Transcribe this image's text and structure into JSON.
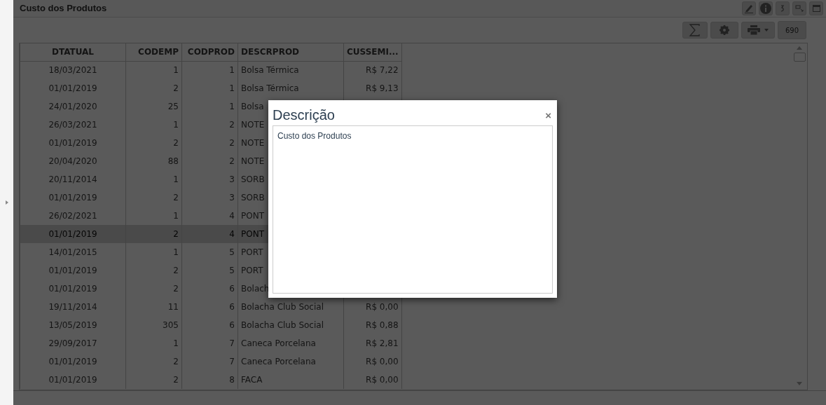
{
  "panel": {
    "title": "Custo dos Produtos",
    "record_count": "690"
  },
  "table": {
    "columns": [
      "DTATUAL",
      "CODEMP",
      "CODPROD",
      "DESCRPROD",
      "CUSSEMI..."
    ],
    "rows": [
      {
        "dtatual": "18/03/2021",
        "codemp": "1",
        "codprod": "1",
        "descrprod": "Bolsa Térmica",
        "cussemi": "R$ 7,22",
        "selected": false
      },
      {
        "dtatual": "01/01/2019",
        "codemp": "2",
        "codprod": "1",
        "descrprod": "Bolsa Térmica",
        "cussemi": "R$ 9,13",
        "selected": false
      },
      {
        "dtatual": "24/01/2020",
        "codemp": "25",
        "codprod": "1",
        "descrprod": "Bolsa",
        "selected": false
      },
      {
        "dtatual": "26/03/2021",
        "codemp": "1",
        "codprod": "2",
        "descrprod": "NOTE",
        "selected": false
      },
      {
        "dtatual": "01/01/2019",
        "codemp": "2",
        "codprod": "2",
        "descrprod": "NOTE",
        "selected": false
      },
      {
        "dtatual": "20/04/2020",
        "codemp": "88",
        "codprod": "2",
        "descrprod": "NOTE",
        "selected": false
      },
      {
        "dtatual": "20/11/2014",
        "codemp": "1",
        "codprod": "3",
        "descrprod": "SORB",
        "selected": false
      },
      {
        "dtatual": "01/01/2019",
        "codemp": "2",
        "codprod": "3",
        "descrprod": "SORB",
        "selected": false
      },
      {
        "dtatual": "26/02/2021",
        "codemp": "1",
        "codprod": "4",
        "descrprod": "PONT",
        "selected": false
      },
      {
        "dtatual": "01/01/2019",
        "codemp": "2",
        "codprod": "4",
        "descrprod": "PONT",
        "selected": true
      },
      {
        "dtatual": "14/01/2015",
        "codemp": "1",
        "codprod": "5",
        "descrprod": "PORT",
        "selected": false
      },
      {
        "dtatual": "01/01/2019",
        "codemp": "2",
        "codprod": "5",
        "descrprod": "PORT",
        "selected": false
      },
      {
        "dtatual": "01/01/2019",
        "codemp": "2",
        "codprod": "6",
        "descrprod": "Bolach",
        "selected": false
      },
      {
        "dtatual": "19/11/2014",
        "codemp": "11",
        "codprod": "6",
        "descrprod": "Bolacha Club Social",
        "cussemi": "R$ 0,00",
        "selected": false
      },
      {
        "dtatual": "13/05/2019",
        "codemp": "305",
        "codprod": "6",
        "descrprod": "Bolacha Club Social",
        "cussemi": "R$ 0,88",
        "selected": false
      },
      {
        "dtatual": "29/09/2017",
        "codemp": "1",
        "codprod": "7",
        "descrprod": "Caneca Porcelana",
        "cussemi": "R$ 2,81",
        "selected": false
      },
      {
        "dtatual": "01/01/2019",
        "codemp": "2",
        "codprod": "7",
        "descrprod": "Caneca Porcelana",
        "cussemi": "R$ 0,00",
        "selected": false
      },
      {
        "dtatual": "01/01/2019",
        "codemp": "2",
        "codprod": "8",
        "descrprod": "FACA",
        "cussemi": "R$ 0,00",
        "selected": false
      }
    ]
  },
  "dialog": {
    "title": "Descrição",
    "close": "×",
    "value": "Custo dos Produtos"
  }
}
